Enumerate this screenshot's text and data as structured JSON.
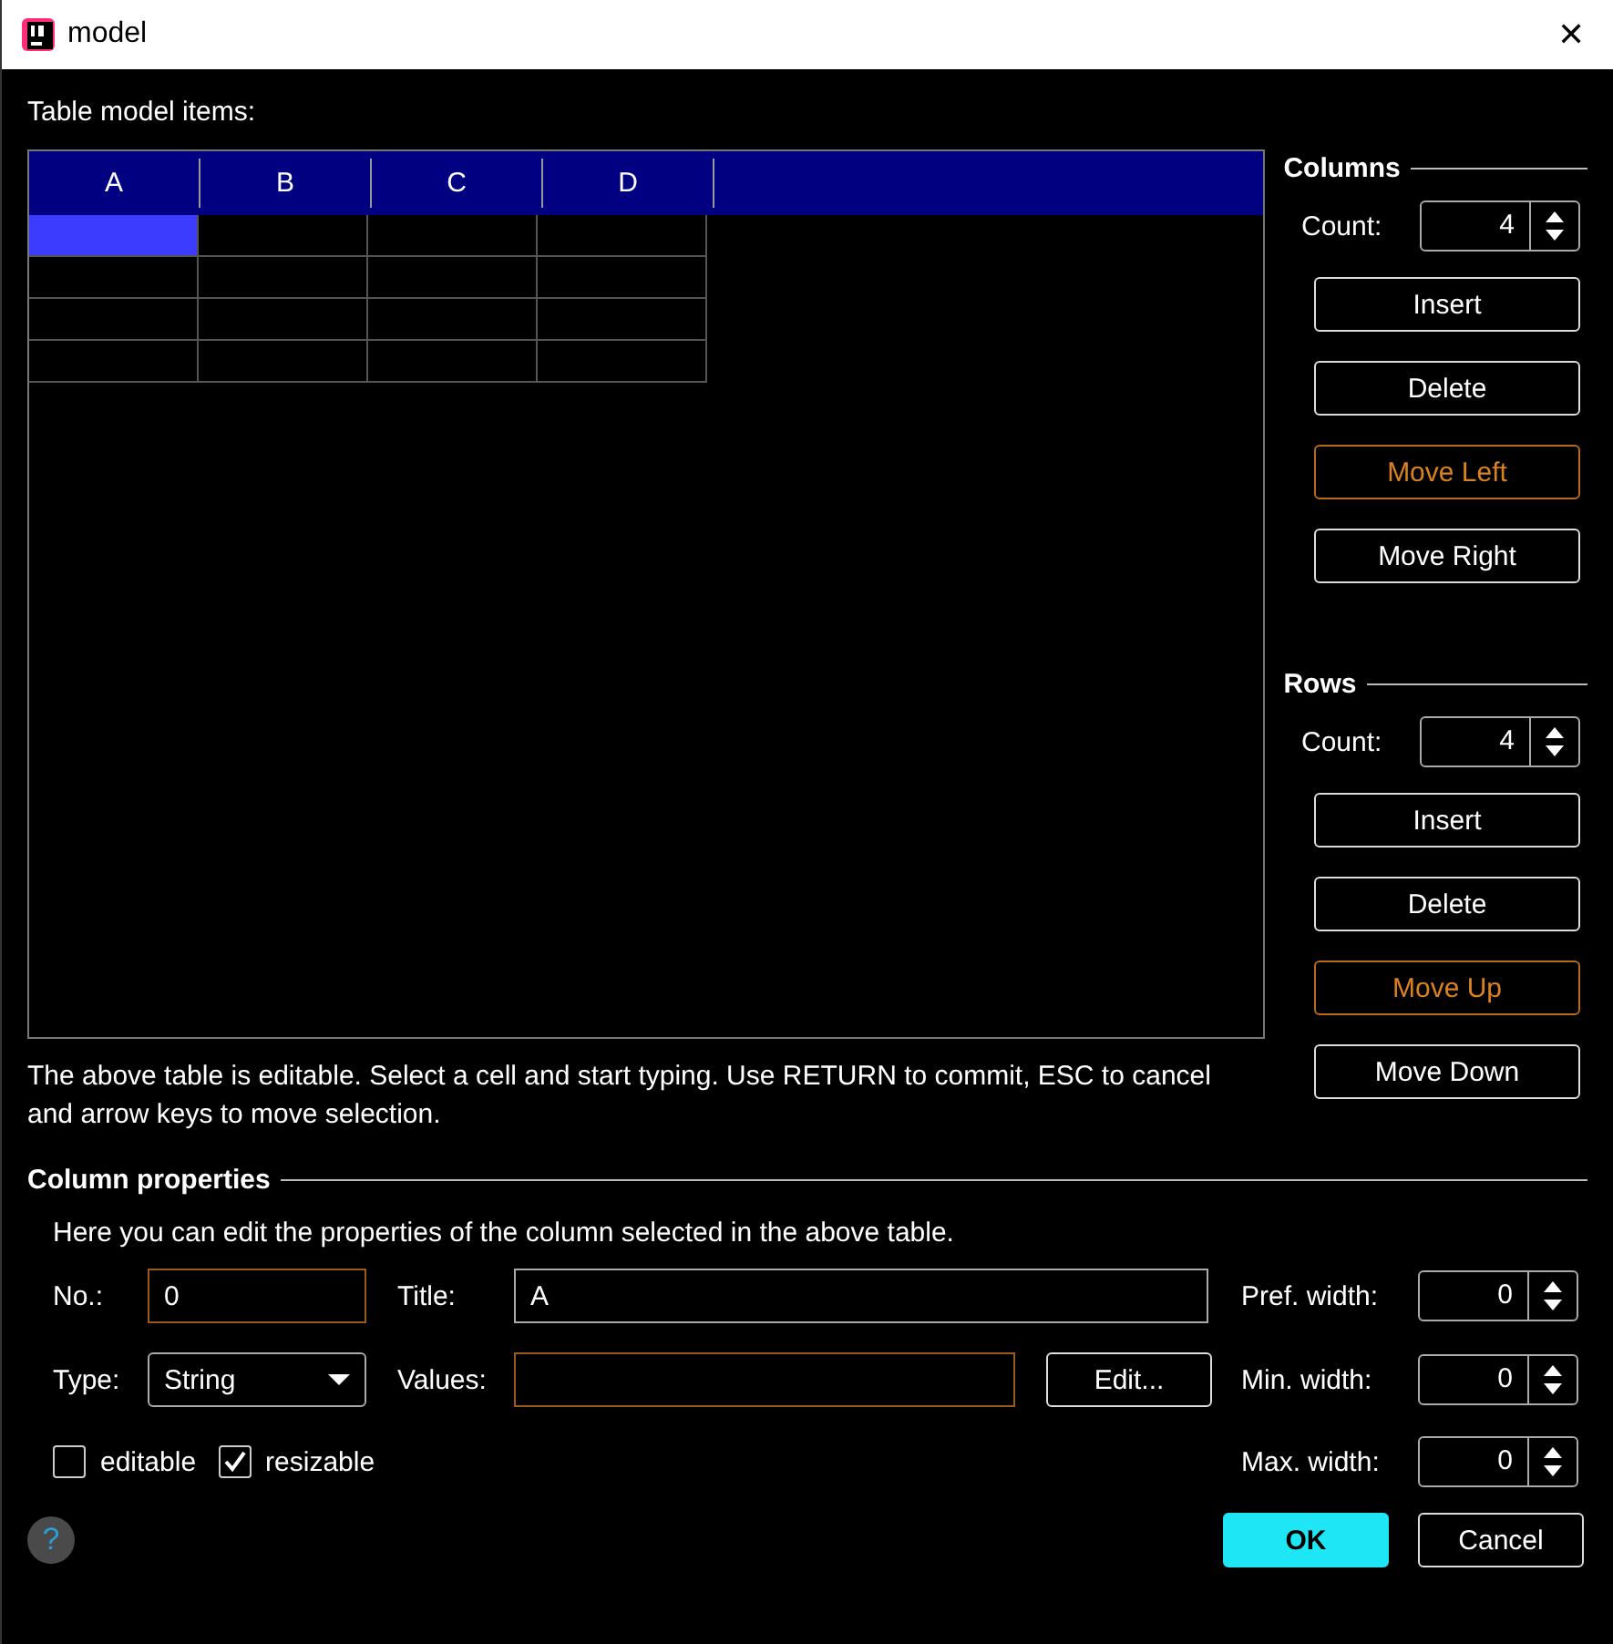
{
  "window": {
    "title": "model",
    "close": "✕"
  },
  "table": {
    "label": "Table model items:",
    "columns": [
      "A",
      "B",
      "C",
      "D"
    ],
    "rows": [
      {
        "cells": [
          {
            "selected": true
          },
          {
            "selected": false
          },
          {
            "selected": false
          },
          {
            "selected": false
          }
        ]
      },
      {
        "cells": [
          {
            "selected": false
          },
          {
            "selected": false
          },
          {
            "selected": false
          },
          {
            "selected": false
          }
        ]
      },
      {
        "cells": [
          {
            "selected": false
          },
          {
            "selected": false
          },
          {
            "selected": false
          },
          {
            "selected": false
          }
        ]
      },
      {
        "cells": [
          {
            "selected": false
          },
          {
            "selected": false
          },
          {
            "selected": false
          },
          {
            "selected": false
          }
        ]
      }
    ],
    "hint": "The above table is editable. Select a cell and start typing. Use RETURN to commit, ESC to cancel and arrow keys to move selection."
  },
  "groups": [
    {
      "title": "Columns",
      "count_label": "Count:",
      "count": "4",
      "buttons": [
        {
          "label": "Insert",
          "disabled": false
        },
        {
          "label": "Delete",
          "disabled": false
        },
        {
          "label": "Move Left",
          "disabled": true
        },
        {
          "label": "Move Right",
          "disabled": false
        }
      ]
    },
    {
      "title": "Rows",
      "count_label": "Count:",
      "count": "4",
      "buttons": [
        {
          "label": "Insert",
          "disabled": false
        },
        {
          "label": "Delete",
          "disabled": false
        },
        {
          "label": "Move Up",
          "disabled": true
        },
        {
          "label": "Move Down",
          "disabled": false
        }
      ]
    }
  ],
  "column_properties": {
    "title": "Column properties",
    "description": "Here you can edit the properties of the column selected in the above table.",
    "number": {
      "label": "No.:",
      "value": "0",
      "highlighted": true
    },
    "title_field": {
      "label": "Title:",
      "value": "A",
      "highlighted": false
    },
    "type": {
      "label": "Type:",
      "value": "String"
    },
    "values": {
      "label": "Values:",
      "highlighted": true,
      "button": "Edit..."
    },
    "widths": [
      {
        "label": "Pref. width:",
        "value": "0"
      },
      {
        "label": "Min. width:",
        "value": "0"
      },
      {
        "label": "Max. width:",
        "value": "0"
      }
    ],
    "checkboxes": [
      {
        "label": "editable",
        "checked": false
      },
      {
        "label": "resizable",
        "checked": true
      }
    ]
  },
  "footer": {
    "help": "?",
    "buttons": [
      {
        "label": "OK",
        "default": true
      },
      {
        "label": "Cancel",
        "default": false
      }
    ]
  }
}
